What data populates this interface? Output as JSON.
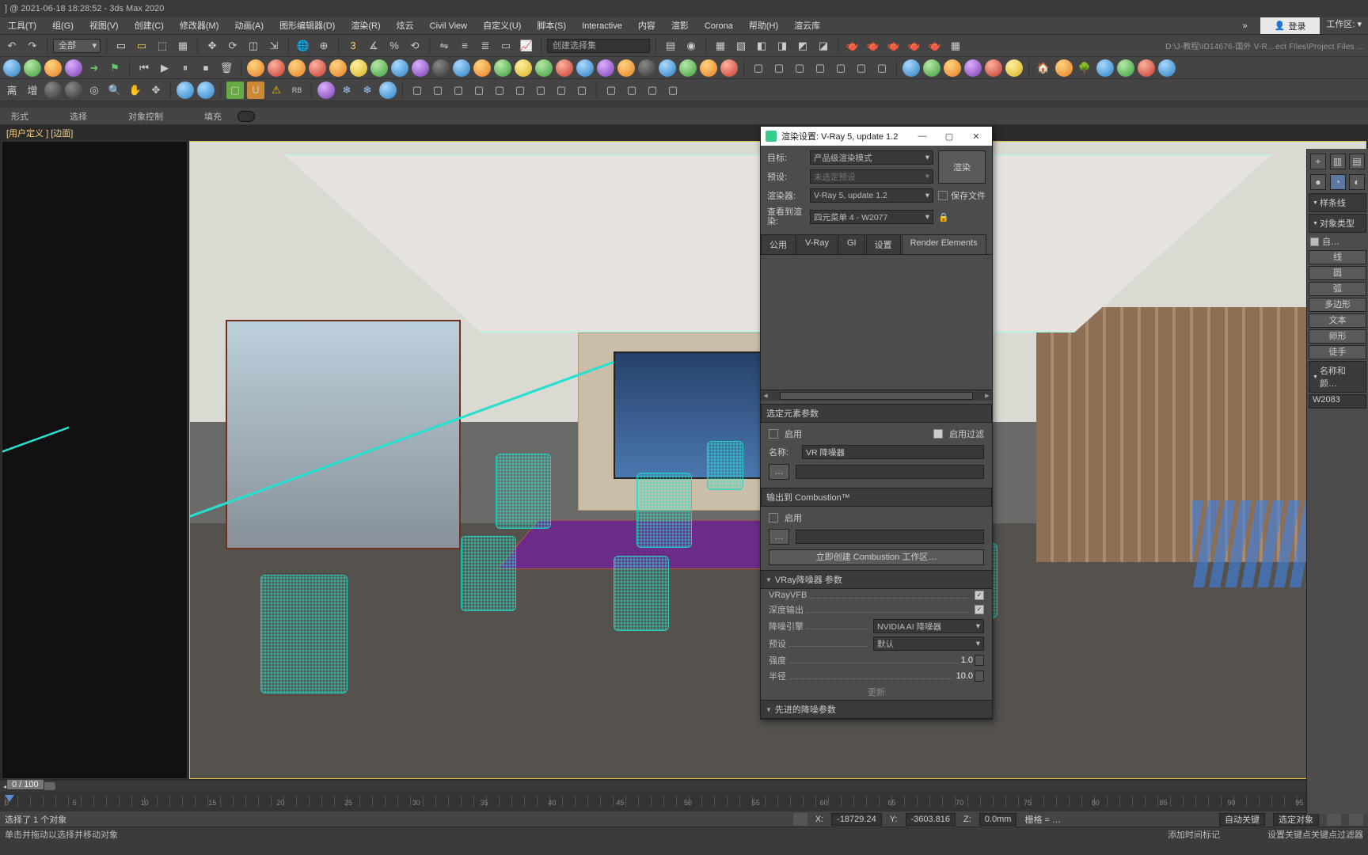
{
  "app": {
    "title_suffix": "] @ 2021-06-18 18:28:52 - 3ds Max 2020"
  },
  "menubar": {
    "items": [
      "工具(T)",
      "组(G)",
      "视图(V)",
      "创建(C)",
      "修改器(M)",
      "动画(A)",
      "图形编辑器(D)",
      "渲染(R)",
      "炫云",
      "Civil View",
      "自定义(U)",
      "脚本(S)",
      "Interactive",
      "内容",
      "渲影",
      "Corona",
      "帮助(H)",
      "渲云库"
    ],
    "login": "登录",
    "workspace": "工作区: "
  },
  "toolbar1": {
    "selector": "全部",
    "pickset_placeholder": "创建选择集",
    "path": "D:\\J-教程\\ID14676-国外 V-R…ect Files\\Project Files …"
  },
  "subtabs": [
    "形式",
    "选择",
    "对象控制",
    "填充"
  ],
  "viewport": {
    "label_prefix": "[用户定义 ]",
    "label_mode": "[边面]"
  },
  "timeline": {
    "min": 0,
    "max": 100,
    "step": 5,
    "current": 0,
    "slider_text": "0 / 100"
  },
  "status": {
    "msg1": "选择了 1 个对象",
    "msg2": "单击并拖动以选择并移动对象",
    "x_lbl": "X:",
    "x": "-18729.24",
    "y_lbl": "Y:",
    "y": "-3603.816",
    "z_lbl": "Z:",
    "z": "0.0mm",
    "grid": "栅格 = …",
    "add_time": "添加时间标记",
    "set_key": "设置关键点",
    "key_filter": "关键点过滤器",
    "chk1": "自动关键",
    "chk2": "选定对象"
  },
  "dialog": {
    "title": "渲染设置: V-Ray 5, update 1.2",
    "rows": {
      "target_lbl": "目标:",
      "target": "产品级渲染模式",
      "preset_lbl": "预设:",
      "preset": "未选定预设",
      "renderer_lbl": "渲染器:",
      "renderer": "V-Ray 5, update 1.2",
      "savefile": "保存文件",
      "view_lbl": "查看到渲染:",
      "view": "四元菜单 4 - W2077",
      "renderbtn": "渲染"
    },
    "tabs": [
      "公用",
      "V-Ray",
      "GI",
      "设置",
      "Render Elements"
    ],
    "sel_elem_hdr": "选定元素参数",
    "enable": "启用",
    "enable_filter": "启用过滤",
    "name_lbl": "名称:",
    "name_val": "VR 降噪器",
    "combust_hdr": "输出到 Combustion™",
    "combust_enable": "启用",
    "combust_btn": "立即创建 Combustion 工作区…",
    "params_hdr": "VRay降噪器  参数",
    "param_vfb": "VRayVFB",
    "param_deep": "深度输出",
    "param_engine_lbl": "降噪引擎",
    "param_engine": "NVIDIA AI 降噪器",
    "param_preset_lbl": "预设",
    "param_preset": "默认",
    "param_strength": "强度",
    "param_strength_v": "1.0",
    "param_radius": "半径",
    "param_radius_v": "10.0",
    "update": "更新",
    "adv_hdr": "先进的降噪参数"
  },
  "cmdpanel": {
    "rollout1": "样条线",
    "rollout2": "对象类型",
    "buttons": [
      "线",
      "圆",
      "弧",
      "多边形",
      "文本",
      "卵形",
      "徒手"
    ],
    "autogrid": "自…",
    "rollout3": "名称和颜…",
    "objname": "W2083"
  }
}
